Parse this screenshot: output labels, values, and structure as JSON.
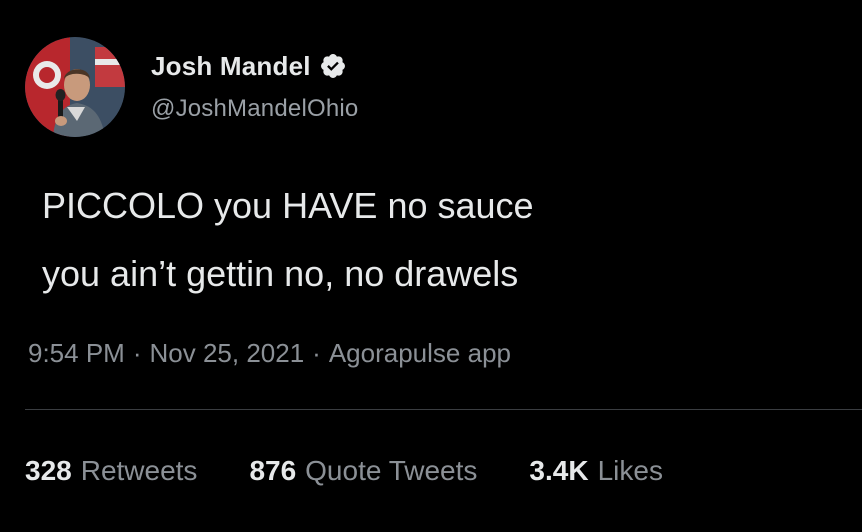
{
  "tweet": {
    "author": {
      "display_name": "Josh Mandel",
      "handle": "@JoshMandelOhio",
      "verified_icon": "verified-badge-icon",
      "avatar_icon": "profile-avatar"
    },
    "text_lines": [
      "PICCOLO you HAVE no sauce",
      "you ain’t gettin no, no drawels"
    ],
    "meta": {
      "time": "9:54 PM",
      "date": "Nov 25, 2021",
      "source": "Agorapulse app",
      "separator": "·"
    },
    "stats": [
      {
        "count": "328",
        "label": "Retweets"
      },
      {
        "count": "876",
        "label": "Quote Tweets"
      },
      {
        "count": "3.4K",
        "label": "Likes"
      }
    ]
  },
  "colors": {
    "background": "#000000",
    "primary_text": "#e7e9ea",
    "secondary_text": "#8b9096",
    "divider": "#3a3d41"
  }
}
